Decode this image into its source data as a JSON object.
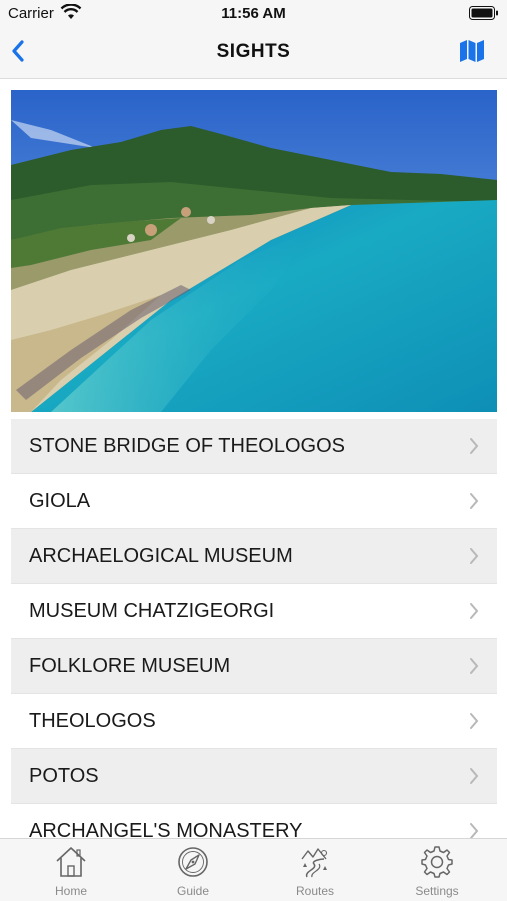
{
  "status_bar": {
    "carrier": "Carrier",
    "time": "11:56 AM"
  },
  "nav": {
    "title": "SIGHTS",
    "back_icon": "chevron-left-icon",
    "map_icon": "map-icon",
    "accent": "#1a73e8"
  },
  "hero": {
    "description_icon": "beach-photo"
  },
  "sights": [
    {
      "label": "STONE BRIDGE OF THEOLOGOS"
    },
    {
      "label": "GIOLA"
    },
    {
      "label": "ARCHAELOGICAL MUSEUM"
    },
    {
      "label": "MUSEUM CHATZIGEORGI"
    },
    {
      "label": "FOLKLORE MUSEUM"
    },
    {
      "label": "THEOLOGOS"
    },
    {
      "label": "POTOS"
    },
    {
      "label": "ARCHANGEL'S MONASTERY"
    }
  ],
  "tabs": [
    {
      "label": "Home",
      "icon": "home-icon"
    },
    {
      "label": "Guide",
      "icon": "compass-icon"
    },
    {
      "label": "Routes",
      "icon": "routes-icon"
    },
    {
      "label": "Settings",
      "icon": "gear-icon"
    }
  ]
}
